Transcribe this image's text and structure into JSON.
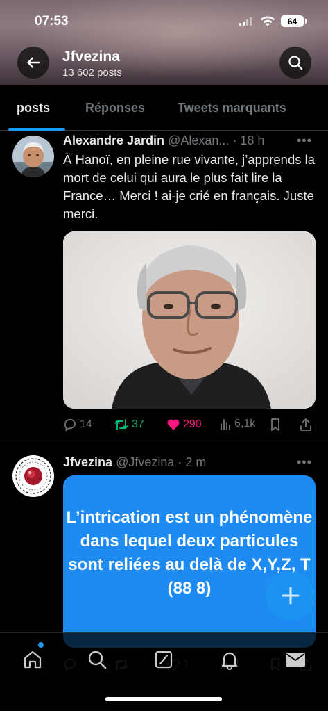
{
  "status_bar": {
    "time": "07:53",
    "battery": "64"
  },
  "header": {
    "title": "Jfvezina",
    "subtitle": "13 602 posts"
  },
  "tabs": [
    {
      "label": "posts",
      "active": true
    },
    {
      "label": "Réponses",
      "active": false
    },
    {
      "label": "Tweets marquants",
      "active": false
    }
  ],
  "tweets": [
    {
      "name": "Alexandre Jardin",
      "handle": "@Alexan...",
      "time": "· 18 h",
      "text": "À Hanoï, en pleine rue vivante, j’apprends la mort de celui qui aura le plus fait lire la France… Merci ! ai-je crié en français. Juste merci.",
      "replies": "14",
      "retweets": "37",
      "likes": "290",
      "views": "6,1k"
    },
    {
      "name": "Jfvezina",
      "handle": "@Jfvezina",
      "time": "· 2 m",
      "card_text": "L’intrication est un phénomène dans lequel deux particules sont reliées au delà de X,Y,Z, T (88 8)",
      "replies": "",
      "likes": "1",
      "views": "1"
    }
  ],
  "colors": {
    "accent": "#1d9bf0",
    "retweet": "#00ba7c",
    "like": "#f91880",
    "card": "#1d8bf1"
  },
  "icons": [
    "back-arrow-icon",
    "search-icon",
    "reply-icon",
    "retweet-icon",
    "heart-icon",
    "views-icon",
    "bookmark-icon",
    "share-icon",
    "more-icon",
    "plus-icon",
    "home-icon",
    "bell-icon",
    "grok-icon",
    "mail-icon"
  ]
}
